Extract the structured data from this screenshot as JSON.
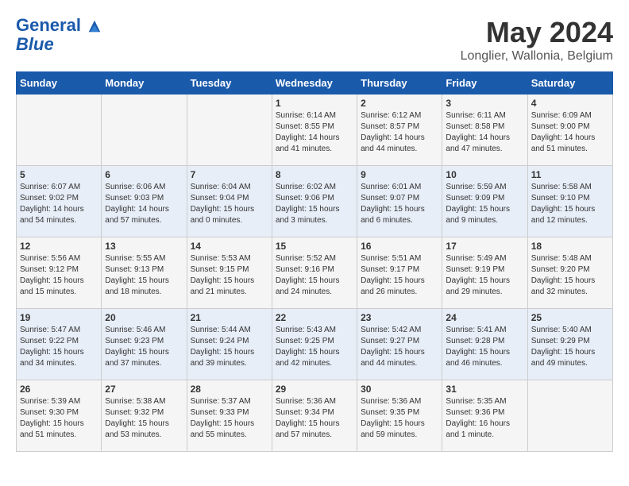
{
  "header": {
    "logo_line1": "General",
    "logo_line2": "Blue",
    "month_title": "May 2024",
    "location": "Longlier, Wallonia, Belgium"
  },
  "days_of_week": [
    "Sunday",
    "Monday",
    "Tuesday",
    "Wednesday",
    "Thursday",
    "Friday",
    "Saturday"
  ],
  "weeks": [
    [
      {
        "day": "",
        "content": ""
      },
      {
        "day": "",
        "content": ""
      },
      {
        "day": "",
        "content": ""
      },
      {
        "day": "1",
        "content": "Sunrise: 6:14 AM\nSunset: 8:55 PM\nDaylight: 14 hours\nand 41 minutes."
      },
      {
        "day": "2",
        "content": "Sunrise: 6:12 AM\nSunset: 8:57 PM\nDaylight: 14 hours\nand 44 minutes."
      },
      {
        "day": "3",
        "content": "Sunrise: 6:11 AM\nSunset: 8:58 PM\nDaylight: 14 hours\nand 47 minutes."
      },
      {
        "day": "4",
        "content": "Sunrise: 6:09 AM\nSunset: 9:00 PM\nDaylight: 14 hours\nand 51 minutes."
      }
    ],
    [
      {
        "day": "5",
        "content": "Sunrise: 6:07 AM\nSunset: 9:02 PM\nDaylight: 14 hours\nand 54 minutes."
      },
      {
        "day": "6",
        "content": "Sunrise: 6:06 AM\nSunset: 9:03 PM\nDaylight: 14 hours\nand 57 minutes."
      },
      {
        "day": "7",
        "content": "Sunrise: 6:04 AM\nSunset: 9:04 PM\nDaylight: 15 hours\nand 0 minutes."
      },
      {
        "day": "8",
        "content": "Sunrise: 6:02 AM\nSunset: 9:06 PM\nDaylight: 15 hours\nand 3 minutes."
      },
      {
        "day": "9",
        "content": "Sunrise: 6:01 AM\nSunset: 9:07 PM\nDaylight: 15 hours\nand 6 minutes."
      },
      {
        "day": "10",
        "content": "Sunrise: 5:59 AM\nSunset: 9:09 PM\nDaylight: 15 hours\nand 9 minutes."
      },
      {
        "day": "11",
        "content": "Sunrise: 5:58 AM\nSunset: 9:10 PM\nDaylight: 15 hours\nand 12 minutes."
      }
    ],
    [
      {
        "day": "12",
        "content": "Sunrise: 5:56 AM\nSunset: 9:12 PM\nDaylight: 15 hours\nand 15 minutes."
      },
      {
        "day": "13",
        "content": "Sunrise: 5:55 AM\nSunset: 9:13 PM\nDaylight: 15 hours\nand 18 minutes."
      },
      {
        "day": "14",
        "content": "Sunrise: 5:53 AM\nSunset: 9:15 PM\nDaylight: 15 hours\nand 21 minutes."
      },
      {
        "day": "15",
        "content": "Sunrise: 5:52 AM\nSunset: 9:16 PM\nDaylight: 15 hours\nand 24 minutes."
      },
      {
        "day": "16",
        "content": "Sunrise: 5:51 AM\nSunset: 9:17 PM\nDaylight: 15 hours\nand 26 minutes."
      },
      {
        "day": "17",
        "content": "Sunrise: 5:49 AM\nSunset: 9:19 PM\nDaylight: 15 hours\nand 29 minutes."
      },
      {
        "day": "18",
        "content": "Sunrise: 5:48 AM\nSunset: 9:20 PM\nDaylight: 15 hours\nand 32 minutes."
      }
    ],
    [
      {
        "day": "19",
        "content": "Sunrise: 5:47 AM\nSunset: 9:22 PM\nDaylight: 15 hours\nand 34 minutes."
      },
      {
        "day": "20",
        "content": "Sunrise: 5:46 AM\nSunset: 9:23 PM\nDaylight: 15 hours\nand 37 minutes."
      },
      {
        "day": "21",
        "content": "Sunrise: 5:44 AM\nSunset: 9:24 PM\nDaylight: 15 hours\nand 39 minutes."
      },
      {
        "day": "22",
        "content": "Sunrise: 5:43 AM\nSunset: 9:25 PM\nDaylight: 15 hours\nand 42 minutes."
      },
      {
        "day": "23",
        "content": "Sunrise: 5:42 AM\nSunset: 9:27 PM\nDaylight: 15 hours\nand 44 minutes."
      },
      {
        "day": "24",
        "content": "Sunrise: 5:41 AM\nSunset: 9:28 PM\nDaylight: 15 hours\nand 46 minutes."
      },
      {
        "day": "25",
        "content": "Sunrise: 5:40 AM\nSunset: 9:29 PM\nDaylight: 15 hours\nand 49 minutes."
      }
    ],
    [
      {
        "day": "26",
        "content": "Sunrise: 5:39 AM\nSunset: 9:30 PM\nDaylight: 15 hours\nand 51 minutes."
      },
      {
        "day": "27",
        "content": "Sunrise: 5:38 AM\nSunset: 9:32 PM\nDaylight: 15 hours\nand 53 minutes."
      },
      {
        "day": "28",
        "content": "Sunrise: 5:37 AM\nSunset: 9:33 PM\nDaylight: 15 hours\nand 55 minutes."
      },
      {
        "day": "29",
        "content": "Sunrise: 5:36 AM\nSunset: 9:34 PM\nDaylight: 15 hours\nand 57 minutes."
      },
      {
        "day": "30",
        "content": "Sunrise: 5:36 AM\nSunset: 9:35 PM\nDaylight: 15 hours\nand 59 minutes."
      },
      {
        "day": "31",
        "content": "Sunrise: 5:35 AM\nSunset: 9:36 PM\nDaylight: 16 hours\nand 1 minute."
      },
      {
        "day": "",
        "content": ""
      }
    ]
  ]
}
